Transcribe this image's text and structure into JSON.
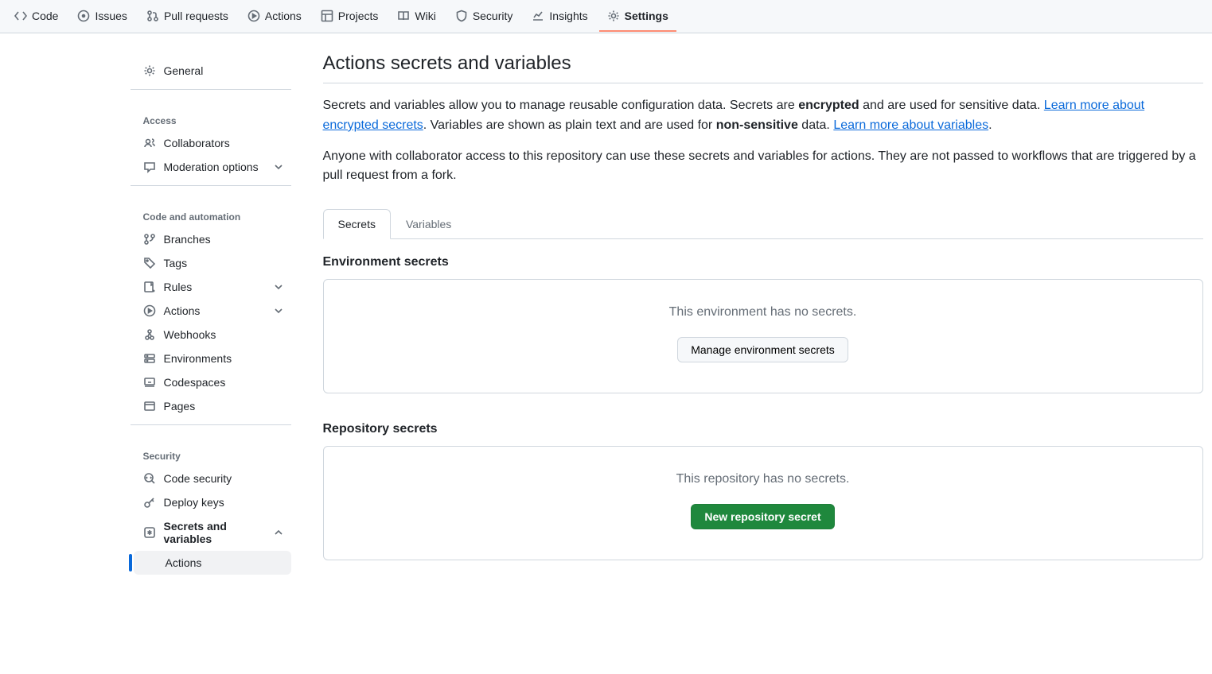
{
  "topnav": [
    {
      "label": "Code",
      "icon": "code"
    },
    {
      "label": "Issues",
      "icon": "issue"
    },
    {
      "label": "Pull requests",
      "icon": "pr"
    },
    {
      "label": "Actions",
      "icon": "play"
    },
    {
      "label": "Projects",
      "icon": "project"
    },
    {
      "label": "Wiki",
      "icon": "book"
    },
    {
      "label": "Security",
      "icon": "shield"
    },
    {
      "label": "Insights",
      "icon": "graph"
    },
    {
      "label": "Settings",
      "icon": "gear",
      "active": true
    }
  ],
  "sidebar": {
    "general_label": "General",
    "access_heading": "Access",
    "collaborators_label": "Collaborators",
    "moderation_label": "Moderation options",
    "code_heading": "Code and automation",
    "branches_label": "Branches",
    "tags_label": "Tags",
    "rules_label": "Rules",
    "actions_label": "Actions",
    "webhooks_label": "Webhooks",
    "environments_label": "Environments",
    "codespaces_label": "Codespaces",
    "pages_label": "Pages",
    "security_heading": "Security",
    "code_security_label": "Code security",
    "deploy_keys_label": "Deploy keys",
    "secrets_vars_label": "Secrets and variables",
    "sub_actions_label": "Actions"
  },
  "main": {
    "title": "Actions secrets and variables",
    "desc1_a": "Secrets and variables allow you to manage reusable configuration data. Secrets are ",
    "desc1_bold": "encrypted",
    "desc1_b": " and are used for sensitive data. ",
    "link1": "Learn more about encrypted secrets",
    "desc1_c": ". Variables are shown as plain text and are used for ",
    "desc1_bold2": "non-sensitive",
    "desc1_d": " data. ",
    "link2": "Learn more about variables",
    "desc1_e": ".",
    "desc2": "Anyone with collaborator access to this repository can use these secrets and variables for actions. They are not passed to workflows that are triggered by a pull request from a fork.",
    "tab_secrets": "Secrets",
    "tab_variables": "Variables",
    "env_heading": "Environment secrets",
    "env_empty": "This environment has no secrets.",
    "env_btn": "Manage environment secrets",
    "repo_heading": "Repository secrets",
    "repo_empty": "This repository has no secrets.",
    "repo_btn": "New repository secret"
  }
}
